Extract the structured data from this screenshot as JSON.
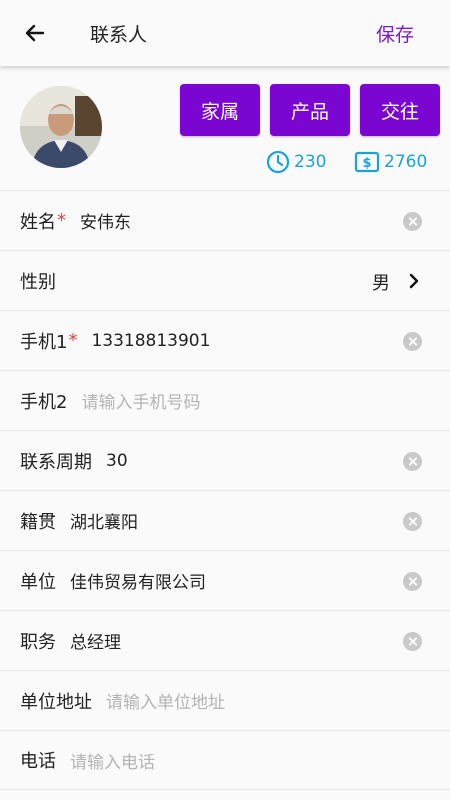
{
  "appbar": {
    "title": "联系人",
    "save_label": "保存",
    "back_icon": "arrow-left-icon"
  },
  "header": {
    "buttons": [
      "家属",
      "产品",
      "交往"
    ],
    "stats": {
      "time_count": "230",
      "money_count": "2760"
    },
    "accent_color": "#7b06d1",
    "stat_color": "#1aa3db"
  },
  "fields": [
    {
      "label": "姓名",
      "required": "*",
      "value": "安伟东"
    },
    {
      "label": "性别",
      "value": "男"
    },
    {
      "label": "手机1",
      "required": "*",
      "value": "13318813901"
    },
    {
      "label": "手机2",
      "placeholder": "请输入手机号码"
    },
    {
      "label": "联系周期",
      "value": "30"
    },
    {
      "label": "籍贯",
      "value": "湖北襄阳"
    },
    {
      "label": "单位",
      "value": "佳伟贸易有限公司"
    },
    {
      "label": "职务",
      "value": "总经理"
    },
    {
      "label": "单位地址",
      "placeholder": "请输入单位地址"
    },
    {
      "label": "电话",
      "placeholder": "请输入电话"
    }
  ]
}
